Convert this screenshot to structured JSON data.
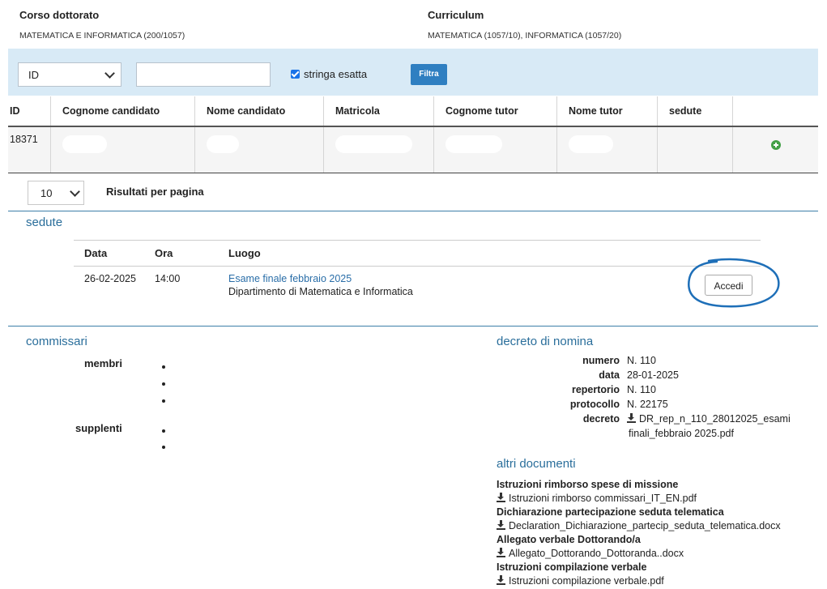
{
  "header": {
    "course_label": "Corso dottorato",
    "course_value": "MATEMATICA E INFORMATICA (200/1057)",
    "curriculum_label": "Curriculum",
    "curriculum_value": "MATEMATICA (1057/10), INFORMATICA (1057/20)"
  },
  "filter": {
    "field_selected": "ID",
    "search_value": "",
    "exact_label": "stringa esatta",
    "exact_checked": true,
    "button_label": "Filtra"
  },
  "table": {
    "columns": [
      "ID",
      "Cognome candidato",
      "Nome candidato",
      "Matricola",
      "Cognome tutor",
      "Nome tutor",
      "sedute",
      ""
    ],
    "rows": [
      {
        "id": "18371"
      }
    ]
  },
  "pagination": {
    "per_page": "10",
    "per_page_label": "Risultati per pagina"
  },
  "sedute": {
    "title": "sedute",
    "columns": [
      "Data",
      "Ora",
      "Luogo"
    ],
    "rows": [
      {
        "data": "26-02-2025",
        "ora": "14:00",
        "luogo_link": "Esame finale febbraio 2025",
        "luogo_desc": "Dipartimento di Matematica e Informatica",
        "action_label": "Accedi"
      }
    ]
  },
  "commissari": {
    "title": "commissari",
    "members_label": "membri",
    "substitutes_label": "supplenti"
  },
  "decreto": {
    "title": "decreto di nomina",
    "fields": [
      {
        "label": "numero",
        "value": "N. 110"
      },
      {
        "label": "data",
        "value": "28-01-2025"
      },
      {
        "label": "repertorio",
        "value": "N. 110"
      },
      {
        "label": "protocollo",
        "value": "N. 22175"
      }
    ],
    "file_label": "decreto",
    "file_line1": "DR_rep_n_110_28012025_esami",
    "file_line2": "finali_febbraio 2025.pdf"
  },
  "altri": {
    "title": "altri documenti",
    "docs": [
      {
        "heading": "Istruzioni rimborso spese di missione",
        "file": "Istruzioni rimborso commissari_IT_EN.pdf"
      },
      {
        "heading": "Dichiarazione partecipazione seduta telematica",
        "file": "Declaration_Dichiarazione_partecip_seduta_telematica.docx"
      },
      {
        "heading": "Allegato verbale Dottorando/a",
        "file": "Allegato_Dottorando_Dottoranda..docx"
      },
      {
        "heading": "Istruzioni compilazione verbale",
        "file": "Istruzioni compilazione verbale.pdf"
      }
    ]
  },
  "colors": {
    "accent": "#2a6e9b",
    "filter_bg": "#d8eaf6",
    "button": "#2f7fc1",
    "add_icon": "#43a047",
    "highlight_circle": "#1e6fb8"
  },
  "icons": [
    "chevron-down-icon",
    "checkbox-checked-icon",
    "plus-circle-icon",
    "download-icon"
  ]
}
